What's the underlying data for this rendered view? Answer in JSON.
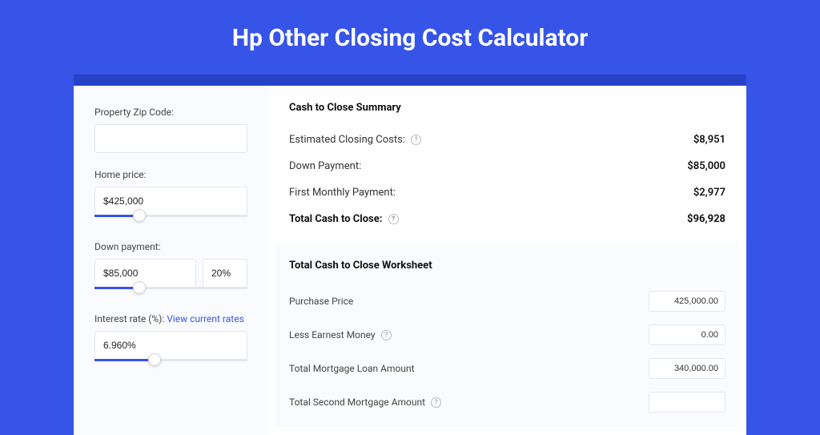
{
  "title": "Hp Other Closing Cost Calculator",
  "sidebar": {
    "zip_label": "Property Zip Code:",
    "zip_value": "",
    "home_price_label": "Home price:",
    "home_price_value": "$425,000",
    "down_payment_label": "Down payment:",
    "down_payment_value": "$85,000",
    "down_payment_pct": "20%",
    "interest_label": "Interest rate (%):",
    "interest_link": "View current rates",
    "interest_value": "6.960%"
  },
  "summary": {
    "title": "Cash to Close Summary",
    "rows": [
      {
        "label": "Estimated Closing Costs:",
        "help": true,
        "value": "$8,951"
      },
      {
        "label": "Down Payment:",
        "help": false,
        "value": "$85,000"
      },
      {
        "label": "First Monthly Payment:",
        "help": false,
        "value": "$2,977"
      }
    ],
    "total_label": "Total Cash to Close:",
    "total_value": "$96,928"
  },
  "worksheet": {
    "title": "Total Cash to Close Worksheet",
    "rows": [
      {
        "label": "Purchase Price",
        "help": false,
        "value": "425,000.00"
      },
      {
        "label": "Less Earnest Money",
        "help": true,
        "value": "0.00"
      },
      {
        "label": "Total Mortgage Loan Amount",
        "help": false,
        "value": "340,000.00"
      },
      {
        "label": "Total Second Mortgage Amount",
        "help": true,
        "value": ""
      }
    ]
  }
}
